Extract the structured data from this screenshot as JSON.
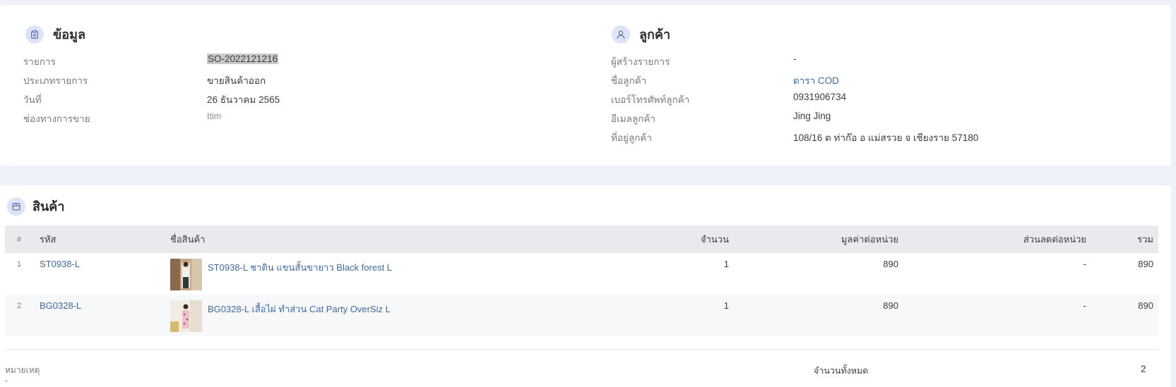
{
  "info": {
    "title": "ข้อมูล",
    "rows": [
      {
        "label": "รายการ",
        "value": "SO-2022121216"
      },
      {
        "label": "ประเภทรายการ",
        "value": "ขายสินค้าออก"
      },
      {
        "label": "วันที่",
        "value": "26 ธันวาคม 2565"
      },
      {
        "label": "ช่องทางการขาย",
        "value": "Itim"
      }
    ]
  },
  "customer": {
    "title": "ลูกค้า",
    "rows": [
      {
        "label": "ผู้สร้างรายการ",
        "value": "-"
      },
      {
        "label": "ชื่อลูกค้า",
        "value": "ดารา COD"
      },
      {
        "label": "เบอร์โทรศัพท์ลูกค้า",
        "value": "0931906734"
      },
      {
        "label": "อีเมลลูกค้า",
        "value": "Jing Jing"
      },
      {
        "label": "ที่อยู่ลูกค้า",
        "value": "108/16 ต ท่าก๊อ อ แม่สรวย จ เชียงราย 57180"
      }
    ]
  },
  "products": {
    "title": "สินค้า",
    "columns": {
      "index": "#",
      "code": "รหัส",
      "name": "ชื่อสินค้า",
      "qty": "จำนวน",
      "unit_price": "มูลค่าต่อหน่วย",
      "unit_discount": "ส่วนลดต่อหน่วย",
      "total": "รวม"
    },
    "items": [
      {
        "index": "1",
        "code": "ST0938-L",
        "name": "ST0938-L ชาติน แขนสั้นขายาว Black forest L",
        "qty": "1",
        "unit_price": "890",
        "unit_discount": "-",
        "total": "890"
      },
      {
        "index": "2",
        "code": "BG0328-L",
        "name": "BG0328-L เสื้อไผ่ ทำส่วน Cat Party OverSiz L",
        "qty": "1",
        "unit_price": "890",
        "unit_discount": "-",
        "total": "890"
      }
    ]
  },
  "footer": {
    "note_label": "หมายเหตุ",
    "note_value": "-",
    "total_qty_label": "จำนวนทั้งหมด",
    "total_qty_value": "2"
  },
  "colors": {
    "accent_link": "#3f6aa6",
    "icon_bg": "#dde4f6",
    "page_bg": "#eef1f7"
  },
  "icons": {
    "info": "clipboard-icon",
    "customer": "user-icon",
    "products": "box-icon"
  }
}
